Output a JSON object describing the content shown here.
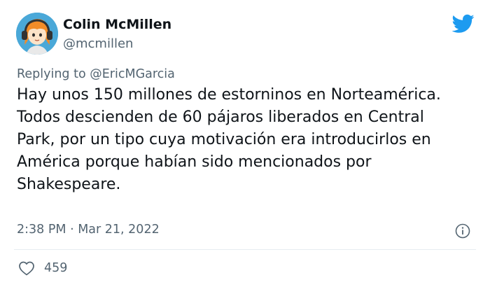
{
  "author": {
    "display_name": "Colin McMillen",
    "handle": "@mcmillen"
  },
  "reply_context": {
    "prefix": "Replying to ",
    "mention": "@EricMGarcia"
  },
  "tweet": {
    "lines": [
      "Hay unos 150 millones de estorninos en Norteamérica.",
      "Todos descienden de 60 pájaros liberados en Central",
      "Park, por un tipo cuya motivación era introducirlos en",
      "América porque habían sido mencionados por",
      "Shakespeare."
    ],
    "timestamp": "2:38 PM · Mar 21, 2022"
  },
  "engagement": {
    "likes": "459"
  },
  "icons": {
    "brand": "twitter-bird-icon",
    "info": "info-icon",
    "like": "heart-icon"
  },
  "colors": {
    "brand": "#1d9bf0",
    "secondary_text": "#536471",
    "primary_text": "#0f1419"
  }
}
